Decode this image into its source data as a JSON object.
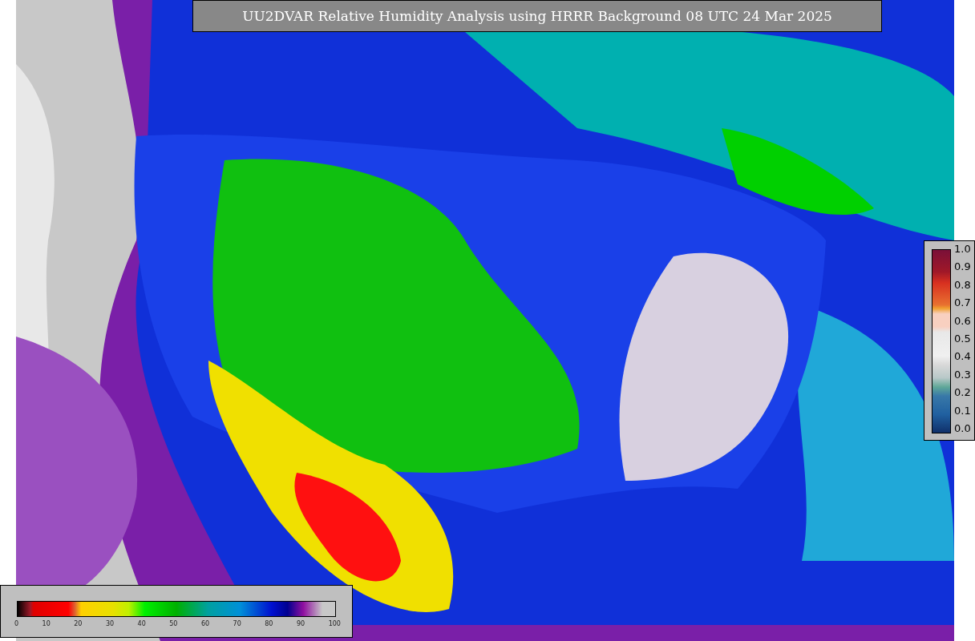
{
  "title": "UU2DVAR Relative Humidity Analysis using HRRR Background 08 UTC 24 Mar 2025",
  "error_scale": {
    "ticks": [
      "1.0",
      "0.9",
      "0.8",
      "0.7",
      "0.6",
      "0.5",
      "0.4",
      "0.3",
      "0.2",
      "0.1",
      "0.0"
    ]
  },
  "humidity_scale": {
    "ticks": [
      "0",
      "10",
      "20",
      "30",
      "40",
      "50",
      "60",
      "70",
      "80",
      "90",
      "100"
    ]
  }
}
